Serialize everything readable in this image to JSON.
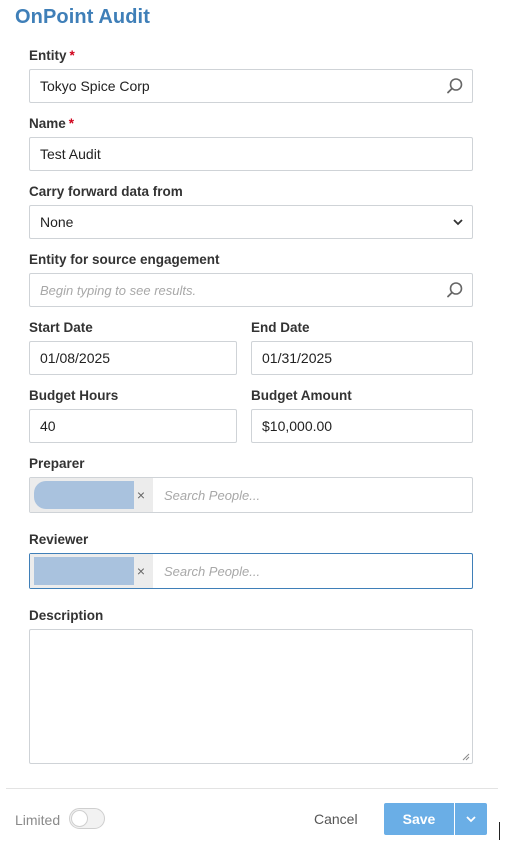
{
  "app": {
    "title": "OnPoint Audit"
  },
  "form": {
    "entity": {
      "label": "Entity",
      "required_mark": "*",
      "value": "Tokyo Spice Corp",
      "icon": "search-icon"
    },
    "name": {
      "label": "Name",
      "required_mark": "*",
      "value": "Test Audit"
    },
    "carry_forward": {
      "label": "Carry forward data from",
      "value": "None",
      "icon": "chevron-down-icon"
    },
    "source_entity": {
      "label": "Entity for source engagement",
      "placeholder": "Begin typing to see results.",
      "icon": "search-icon"
    },
    "start_date": {
      "label": "Start Date",
      "value": "01/08/2025"
    },
    "end_date": {
      "label": "End Date",
      "value": "01/31/2025"
    },
    "budget_hours": {
      "label": "Budget Hours",
      "value": "40"
    },
    "budget_amount": {
      "label": "Budget Amount",
      "value": "$10,000.00"
    },
    "preparer": {
      "label": "Preparer",
      "remove_glyph": "×",
      "placeholder": "Search People..."
    },
    "reviewer": {
      "label": "Reviewer",
      "remove_glyph": "×",
      "placeholder": "Search People..."
    },
    "description": {
      "label": "Description",
      "value": ""
    }
  },
  "footer": {
    "limited_label": "Limited",
    "limited_on": false,
    "cancel_label": "Cancel",
    "save_label": "Save"
  },
  "colors": {
    "accent": "#3f7fb8",
    "save_button": "#6aaee6",
    "required": "#d0021b"
  }
}
